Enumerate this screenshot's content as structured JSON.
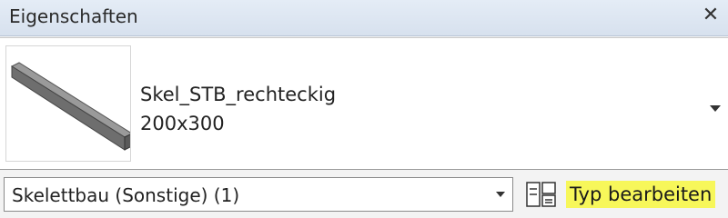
{
  "window": {
    "title": "Eigenschaften",
    "close_icon": "close-icon"
  },
  "type_selector": {
    "preview_icon": "beam-preview-icon",
    "family_name": "Skel_STB_rechteckig",
    "type_size": "200x300",
    "dropdown_icon": "chevron-down-icon"
  },
  "instance_filter": {
    "value": "Skelettbau (Sonstige) (1)"
  },
  "edit_type": {
    "icon": "edit-type-icon",
    "label": "Typ bearbeiten",
    "highlight_color": "#f7f75a"
  }
}
